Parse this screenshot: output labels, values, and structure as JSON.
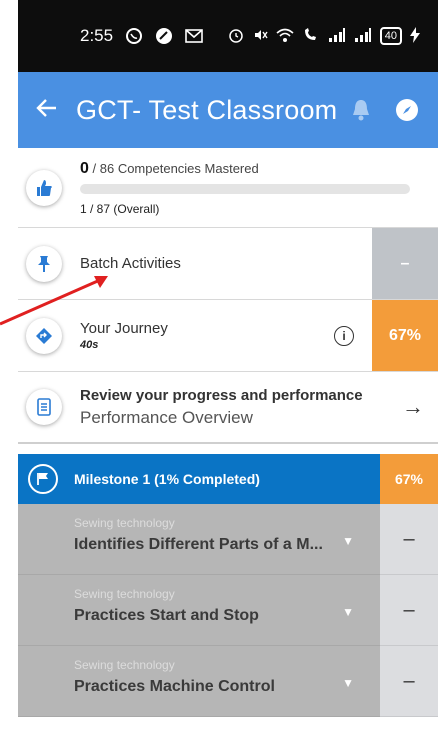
{
  "status_bar": {
    "time": "2:55",
    "icons_left": [
      "whatsapp-icon",
      "notification-icon",
      "gmail-icon"
    ],
    "icons_right": [
      "alarm-icon",
      "mute-icon",
      "wifi-icon",
      "wifi-call-icon",
      "signal-icon",
      "signal-icon"
    ],
    "battery": "40"
  },
  "app_bar": {
    "title": "GCT- Test Classroom"
  },
  "competency": {
    "mastered": "0",
    "mastered_text": " / 86 Competencies Mastered",
    "overall": "1 / 87 (Overall)",
    "progress_fraction": 0.0
  },
  "batch": {
    "label": "Batch Activities",
    "tile": "–"
  },
  "journey": {
    "title": "Your Journey",
    "sub": "40s",
    "percent": "67%"
  },
  "review": {
    "title": "Review your progress and performance",
    "subtitle": "Performance Overview"
  },
  "milestone": {
    "label": "Milestone 1 (1% Completed)",
    "percent": "67%"
  },
  "tasks": [
    {
      "category": "Sewing technology",
      "name": "Identifies Different Parts of a M...",
      "side": "–"
    },
    {
      "category": "Sewing technology",
      "name": "Practices Start and Stop",
      "side": "–"
    },
    {
      "category": "Sewing technology",
      "name": "Practices Machine Control",
      "side": "–"
    }
  ],
  "colors": {
    "app_bar": "#4a90e2",
    "milestone": "#0a74c5",
    "accent_orange": "#f39c3a",
    "annotation_arrow": "#e02020"
  }
}
